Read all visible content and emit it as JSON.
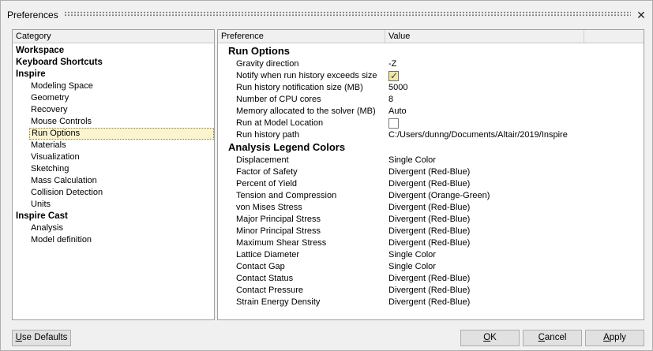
{
  "window": {
    "title": "Preferences",
    "close_glyph": "✕"
  },
  "category_panel": {
    "header": "Category",
    "items": [
      {
        "label": "Workspace",
        "level": 0
      },
      {
        "label": "Keyboard Shortcuts",
        "level": 0
      },
      {
        "label": "Inspire",
        "level": 0
      },
      {
        "label": "Modeling Space",
        "level": 1
      },
      {
        "label": "Geometry",
        "level": 1
      },
      {
        "label": "Recovery",
        "level": 1
      },
      {
        "label": "Mouse Controls",
        "level": 1
      },
      {
        "label": "Run Options",
        "level": 1,
        "selected": true
      },
      {
        "label": "Materials",
        "level": 1
      },
      {
        "label": "Visualization",
        "level": 1
      },
      {
        "label": "Sketching",
        "level": 1
      },
      {
        "label": "Mass Calculation",
        "level": 1
      },
      {
        "label": "Collision Detection",
        "level": 1
      },
      {
        "label": "Units",
        "level": 1
      },
      {
        "label": "Inspire Cast",
        "level": 0
      },
      {
        "label": "Analysis",
        "level": 1
      },
      {
        "label": "Model definition",
        "level": 1
      }
    ]
  },
  "preference_panel": {
    "header_preference": "Preference",
    "header_value": "Value",
    "sections": [
      {
        "title": "Run Options",
        "rows": [
          {
            "label": "Gravity direction",
            "value": "-Z"
          },
          {
            "label": "Notify when run history exceeds size",
            "checkbox": true,
            "checked": true
          },
          {
            "label": "Run history notification size (MB)",
            "value": "5000"
          },
          {
            "label": "Number of CPU cores",
            "value": "8"
          },
          {
            "label": "Memory allocated to the solver (MB)",
            "value": "Auto"
          },
          {
            "label": "Run at Model Location",
            "checkbox": true,
            "checked": false
          },
          {
            "label": "Run history path",
            "value": "C:/Users/dunng/Documents/Altair/2019/Inspire"
          }
        ]
      },
      {
        "title": "Analysis Legend Colors",
        "rows": [
          {
            "label": "Displacement",
            "value": "Single Color"
          },
          {
            "label": "Factor of Safety",
            "value": "Divergent (Red-Blue)"
          },
          {
            "label": "Percent of Yield",
            "value": "Divergent (Red-Blue)"
          },
          {
            "label": "Tension and Compression",
            "value": "Divergent (Orange-Green)"
          },
          {
            "label": "von Mises Stress",
            "value": "Divergent (Red-Blue)"
          },
          {
            "label": "Major Principal Stress",
            "value": "Divergent (Red-Blue)"
          },
          {
            "label": "Minor Principal Stress",
            "value": "Divergent (Red-Blue)"
          },
          {
            "label": "Maximum Shear Stress",
            "value": "Divergent (Red-Blue)"
          },
          {
            "label": "Lattice Diameter",
            "value": "Single Color"
          },
          {
            "label": "Contact Gap",
            "value": "Single Color"
          },
          {
            "label": "Contact Status",
            "value": "Divergent (Red-Blue)"
          },
          {
            "label": "Contact Pressure",
            "value": "Divergent (Red-Blue)"
          },
          {
            "label": "Strain Energy Density",
            "value": "Divergent (Red-Blue)"
          }
        ]
      }
    ]
  },
  "buttons": {
    "use_defaults": {
      "prefix": "",
      "accel": "U",
      "rest": "se Defaults"
    },
    "ok": {
      "prefix": "",
      "accel": "O",
      "rest": "K"
    },
    "cancel": {
      "prefix": "",
      "accel": "C",
      "rest": "ancel"
    },
    "apply": {
      "prefix": "",
      "accel": "A",
      "rest": "pply"
    }
  },
  "colors": {
    "selection_bg": "#fbf4cf",
    "checkbox_checked_bg": "#f5e79e",
    "check_mark": "#1b3f7a"
  }
}
